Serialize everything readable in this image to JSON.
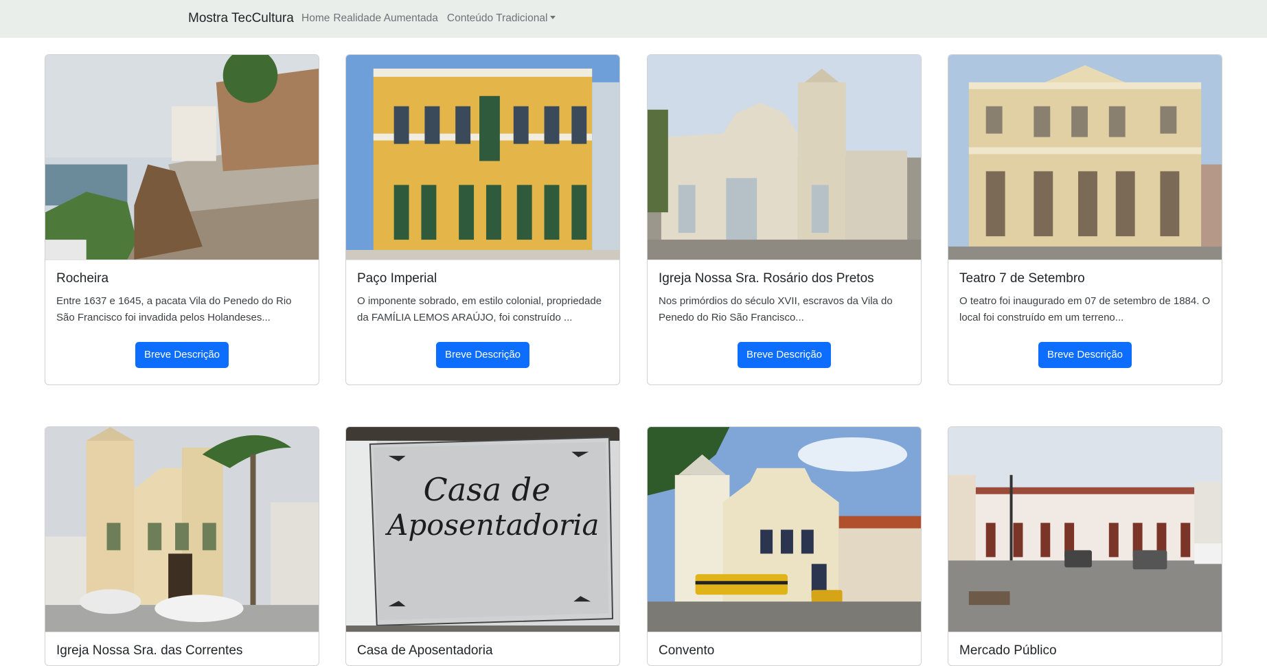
{
  "navbar": {
    "brand": "Mostra TecCultura",
    "links": [
      "Home",
      "Realidade Aumentada"
    ],
    "dropdown_label": "Conteúdo Tradicional"
  },
  "button_label": "Breve Descrição",
  "cards": [
    {
      "title": "Rocheira",
      "text": "Entre 1637 e 1645, a pacata Vila do Penedo do Rio São Francisco foi invadida pelos Holandeses..."
    },
    {
      "title": "Paço Imperial",
      "text": "O imponente sobrado, em estilo colonial, propriedade da FAMÍLIA LEMOS ARAÚJO, foi construído ..."
    },
    {
      "title": "Igreja Nossa Sra. Rosário dos Pretos",
      "text": "Nos primórdios do século XVII, escravos da Vila do Penedo do Rio São Francisco..."
    },
    {
      "title": "Teatro 7 de Setembro",
      "text": "O teatro foi inaugurado em 07 de setembro de 1884. O local foi construído em um terreno..."
    },
    {
      "title": "Igreja Nossa Sra. das Correntes",
      "text": ""
    },
    {
      "title": "Casa de Aposentadoria",
      "text": ""
    },
    {
      "title": "Convento",
      "text": ""
    },
    {
      "title": "Mercado Público",
      "text": ""
    }
  ],
  "sign_text": [
    "Casa de",
    "Aposentadoria"
  ]
}
